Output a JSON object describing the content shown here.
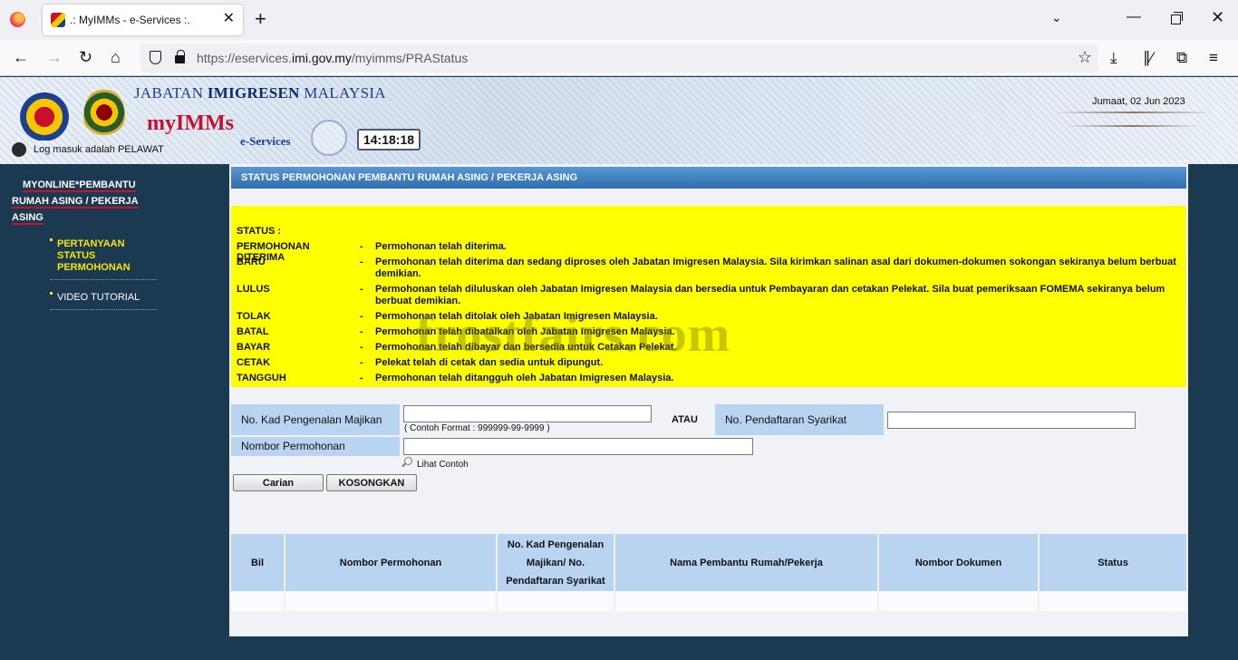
{
  "browser": {
    "tab_title": ".: MyIMMs - e-Services :.",
    "tab_close": "✕",
    "new_tab": "+",
    "url_prefix": "https://eservices.",
    "url_domain": "imi.gov.my",
    "url_path": "/myimms/PRAStatus"
  },
  "header": {
    "jabatan_part1": "JABATAN ",
    "jabatan_part2": "IMIGRESEN",
    "jabatan_part3": " MALAYSIA",
    "app_name": "myIMMs",
    "app_sub": "e-Services",
    "clock": "14:18:18",
    "login_text": "Log masuk adalah PELAWAT",
    "date": "Jumaat, 02 Jun 2023"
  },
  "sidebar": {
    "title_l1": "MYONLINE*PEMBANTU",
    "title_l2": "RUMAH ASING / PEKERJA",
    "title_l3": "ASING",
    "items": [
      {
        "l1": "PERTANYAAN",
        "l2": "STATUS",
        "l3": "PERMOHONAN"
      },
      {
        "l1": "VIDEO TUTORIAL"
      }
    ]
  },
  "main": {
    "title": "STATUS PERMOHONAN PEMBANTU RUMAH ASING / PEKERJA ASING",
    "status_heading": "STATUS :",
    "dash": "-",
    "statuses": [
      {
        "key": "PERMOHONAN DITERIMA",
        "desc": "Permohonan telah diterima."
      },
      {
        "key": "BARU",
        "desc": "Permohonan telah diterima dan sedang diproses oleh Jabatan Imigresen Malaysia. Sila kirimkan salinan asal dari dokumen-dokumen sokongan sekiranya belum berbuat demikian."
      },
      {
        "key": "LULUS",
        "desc": "Permohonan telah diluluskan oleh Jabatan Imigresen Malaysia dan bersedia untuk Pembayaran dan cetakan Pelekat. Sila buat pemeriksaan FOMEMA sekiranya belum berbuat demikian."
      },
      {
        "key": "TOLAK",
        "desc": "Permohonan telah ditolak oleh Jabatan Imigresen Malaysia."
      },
      {
        "key": "BATAL",
        "desc": "Permohonan telah dibatalkan oleh Jabatan Imigresen Malaysia."
      },
      {
        "key": "BAYAR",
        "desc": "Permohonan telah dibayar dan bersedia untuk Cetakan Pelekat."
      },
      {
        "key": "CETAK",
        "desc": "Pelekat telah di cetak dan sedia untuk dipungut."
      },
      {
        "key": "TANGGUH",
        "desc": "Permohonan telah ditangguh oleh Jabatan Imigresen Malaysia."
      }
    ],
    "watermark": "frostfairs.com",
    "form": {
      "ic_label": "No. Kad Pengenalan Majikan",
      "ic_value": "",
      "ic_hint": "( Contoh Format : 999999-99-9999 )",
      "atau": "ATAU",
      "company_label": "No. Pendaftaran Syarikat",
      "company_value": "",
      "app_no_label": "Nombor Permohonan",
      "app_no_value": "",
      "lihat_contoh": "Lihat Contoh",
      "search_button": "Carian",
      "clear_button": "KOSONGKAN"
    },
    "table": {
      "headers": {
        "bil": "Bil",
        "app_no": "Nombor Permohonan",
        "ic_l1": "No. Kad Pengenalan",
        "ic_l2": "Majikan/ No.",
        "ic_l3": "Pendaftaran Syarikat",
        "name": "Nama Pembantu Rumah/Pekerja",
        "doc": "Nombor Dokumen",
        "status": "Status"
      }
    }
  }
}
